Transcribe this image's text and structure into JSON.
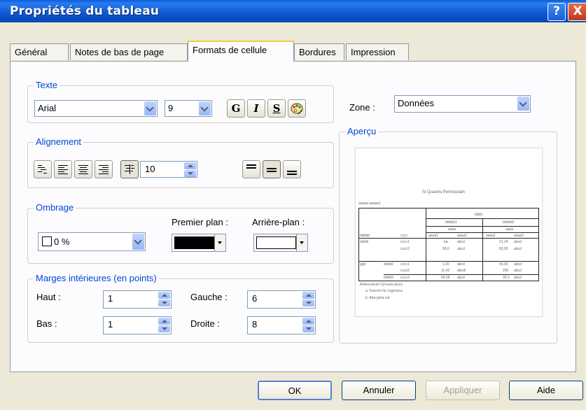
{
  "window": {
    "title": "Propriétés du tableau",
    "help_glyph": "?",
    "close_glyph": "X"
  },
  "tabs": [
    {
      "label": "Général"
    },
    {
      "label": "Notes de bas de page"
    },
    {
      "label": "Formats de cellule"
    },
    {
      "label": "Bordures"
    },
    {
      "label": "Impression"
    }
  ],
  "text_group": {
    "label": "Texte",
    "font": "Arial",
    "size": "9",
    "bold_label": "G",
    "italic_label": "I",
    "underline_label": "S"
  },
  "zone": {
    "label": "Zone :",
    "value": "Données"
  },
  "alignment": {
    "label": "Alignement",
    "decimal_value": "10"
  },
  "shading": {
    "label": "Ombrage",
    "percent": "0 %",
    "foreground_label": "Premier plan :",
    "background_label": "Arrière-plan :",
    "foreground_color": "#000000",
    "background_color": "#ffffff"
  },
  "margins": {
    "label": "Marges intérieures (en points)",
    "top_label": "Haut :",
    "top": "1",
    "bottom_label": "Bas :",
    "bottom": "1",
    "left_label": "Gauche :",
    "left": "6",
    "right_label": "Droite :",
    "right": "8"
  },
  "preview": {
    "label": "Aperçu",
    "title_text": "Si Quaeris Peninsulam",
    "layer_text": "aaaaa aaaaa1",
    "top_header": "bbbb",
    "col_group1": "bbbbb1",
    "col_group2": "bbbbb2",
    "sub1": "aaaa",
    "sub2": "aaaa",
    "headers": [
      "ddddd",
      "cccc",
      "aaaa1",
      "aaaa2",
      "aaaa1",
      "aaaa2"
    ],
    "rows": [
      [
        "ddddi",
        "cccc1",
        "ba",
        "abcd",
        "21,24",
        "abcd"
      ],
      [
        "",
        "cccc2",
        "99,0",
        "abcd",
        "83,05",
        "abcd"
      ],
      [
        "ggd",
        "cccc1",
        "1,05",
        "abcd",
        "56,05",
        "abcd"
      ],
      [
        "",
        "cccc2",
        "11,42",
        "abcdt",
        "205",
        "abcd"
      ],
      [
        "",
        "cccc3",
        "60,05",
        "abcd",
        "30,0",
        "abcd"
      ]
    ],
    "row_group2": "dddd2",
    "row_group3": "dddd3",
    "footnote1": "Americanum Circuum piscs",
    "footnote2": "a. Fuerem fur cognosca",
    "footnote3": "b. Atra jacta est"
  },
  "buttons": {
    "ok": "OK",
    "cancel": "Annuler",
    "apply": "Appliquer",
    "help": "Aide"
  }
}
